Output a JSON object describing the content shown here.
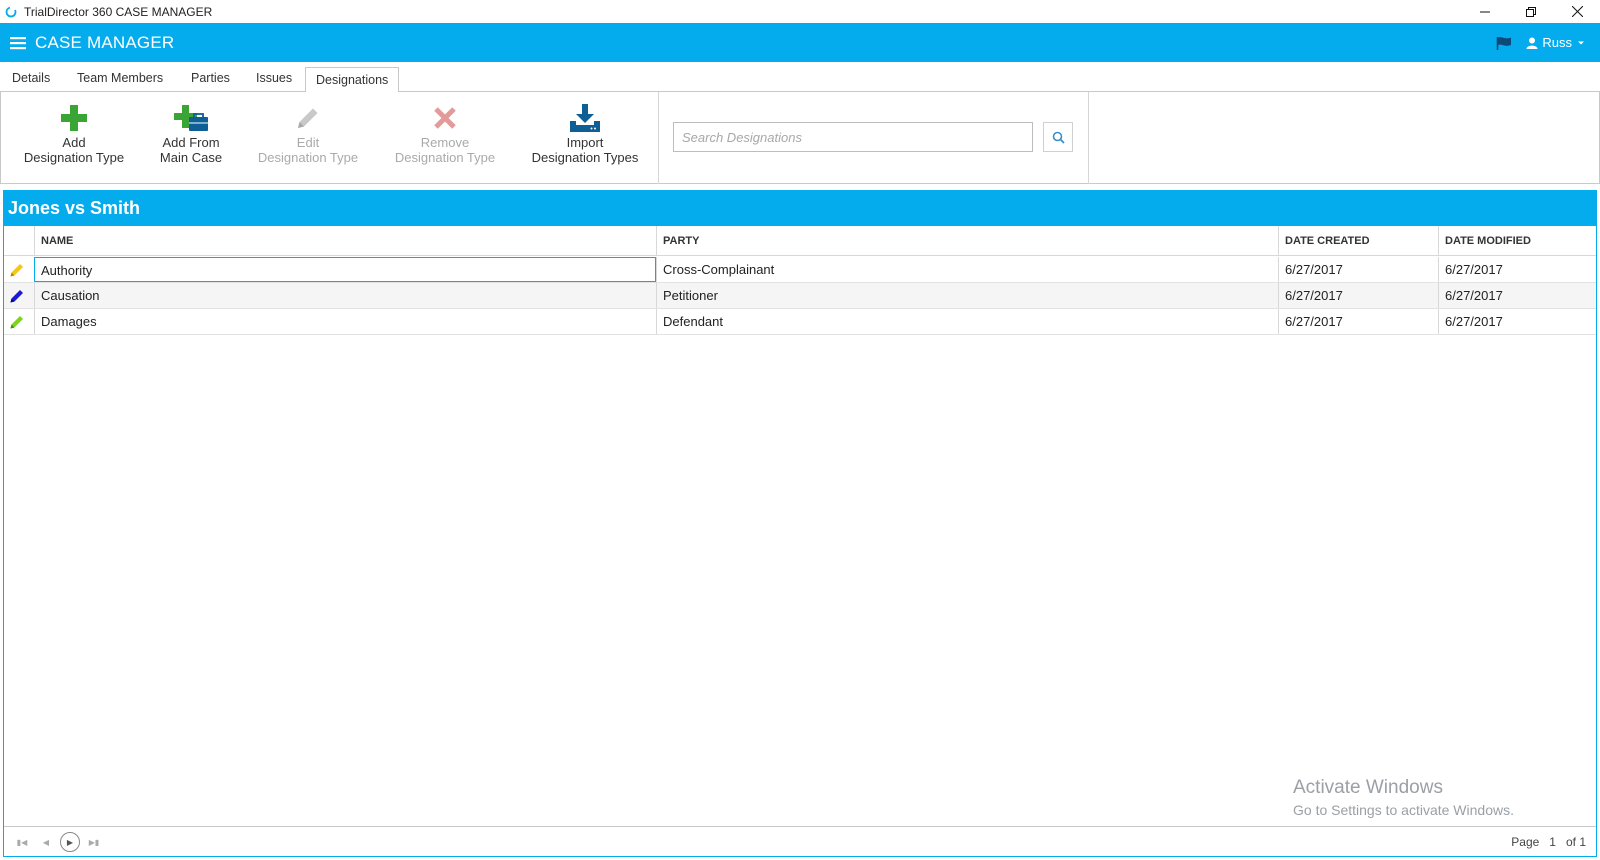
{
  "window": {
    "title": "TrialDirector 360 CASE MANAGER"
  },
  "appbar": {
    "title": "CASE MANAGER",
    "user_name": "Russ"
  },
  "tabs": [
    {
      "label": "Details"
    },
    {
      "label": "Team Members"
    },
    {
      "label": "Parties"
    },
    {
      "label": "Issues"
    },
    {
      "label": "Designations"
    }
  ],
  "toolbar": {
    "add_designation_type": {
      "line1": "Add",
      "line2": "Designation Type"
    },
    "add_from_main_case": {
      "line1": "Add From",
      "line2": "Main Case"
    },
    "edit_designation_type": {
      "line1": "Edit",
      "line2": "Designation Type"
    },
    "remove_designation_type": {
      "line1": "Remove",
      "line2": "Designation Type"
    },
    "import_designation_types": {
      "line1": "Import",
      "line2": "Designation Types"
    }
  },
  "search": {
    "placeholder": "Search Designations",
    "value": ""
  },
  "case": {
    "title": "Jones vs Smith"
  },
  "grid": {
    "columns": {
      "name": "NAME",
      "party": "PARTY",
      "date_created": "DATE CREATED",
      "date_modified": "DATE MODIFIED"
    },
    "rows": [
      {
        "name": "Authority",
        "party": "Cross-Complainant",
        "date_created": "6/27/2017",
        "date_modified": "6/27/2017",
        "color": "#f5c518"
      },
      {
        "name": "Causation",
        "party": "Petitioner",
        "date_created": "6/27/2017",
        "date_modified": "6/27/2017",
        "color": "#1b1bd6"
      },
      {
        "name": "Damages",
        "party": "Defendant",
        "date_created": "6/27/2017",
        "date_modified": "6/27/2017",
        "color": "#7ed321"
      }
    ]
  },
  "pager": {
    "page_label": "Page",
    "current_page": "1",
    "total_label": "of 1"
  },
  "watermark": {
    "line1": "Activate Windows",
    "line2": "Go to Settings to activate Windows."
  },
  "colors": {
    "accent": "#05aced"
  }
}
